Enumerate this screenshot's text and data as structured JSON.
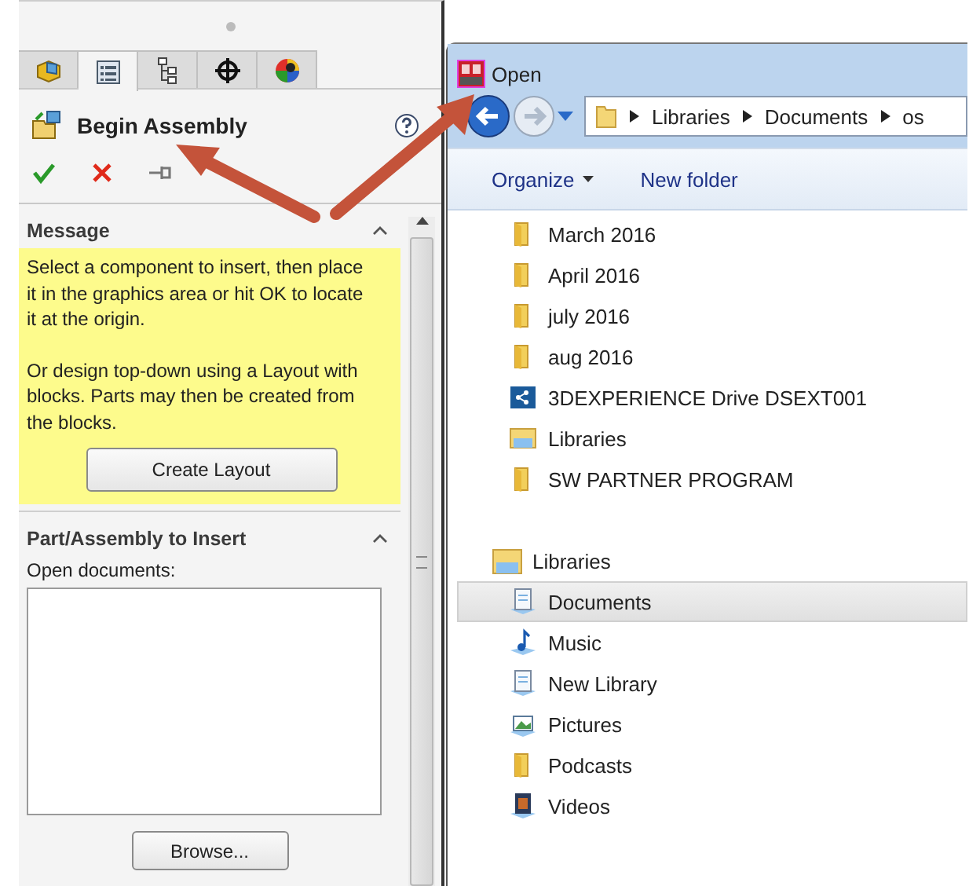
{
  "property_manager": {
    "tabs": [
      {
        "kind": "part",
        "selected": false
      },
      {
        "kind": "properties",
        "selected": true
      },
      {
        "kind": "config",
        "selected": false
      },
      {
        "kind": "origin",
        "selected": false
      },
      {
        "kind": "appearance",
        "selected": false
      }
    ],
    "title": "Begin Assembly",
    "message": {
      "title": "Message",
      "paragraphs": [
        "Select a component to insert, then place it in the graphics area or hit OK to locate it at the origin.",
        "Or design top-down using a Layout with blocks. Parts may then be created from the blocks."
      ],
      "button": "Create Layout"
    },
    "insert": {
      "title": "Part/Assembly to Insert",
      "label": "Open documents:",
      "button": "Browse..."
    }
  },
  "open_dialog": {
    "title": "Open",
    "breadcrumb": [
      "Libraries",
      "Documents",
      "os"
    ],
    "toolbar": {
      "organize": "Organize",
      "new_folder": "New folder"
    },
    "folders": [
      {
        "label": "March 2016",
        "kind": "folder"
      },
      {
        "label": "April 2016",
        "kind": "folder"
      },
      {
        "label": "july 2016",
        "kind": "folder"
      },
      {
        "label": "aug 2016",
        "kind": "folder"
      },
      {
        "label": "3DEXPERIENCE Drive DSEXT001",
        "kind": "drive"
      },
      {
        "label": "Libraries",
        "kind": "library"
      },
      {
        "label": "SW PARTNER PROGRAM",
        "kind": "folder"
      }
    ],
    "libraries": {
      "label": "Libraries",
      "children": [
        {
          "label": "Documents",
          "kind": "documents",
          "selected": true
        },
        {
          "label": "Music",
          "kind": "music",
          "selected": false
        },
        {
          "label": "New Library",
          "kind": "library-doc",
          "selected": false
        },
        {
          "label": "Pictures",
          "kind": "pictures",
          "selected": false
        },
        {
          "label": "Podcasts",
          "kind": "folder",
          "selected": false
        },
        {
          "label": "Videos",
          "kind": "videos",
          "selected": false
        }
      ]
    }
  }
}
